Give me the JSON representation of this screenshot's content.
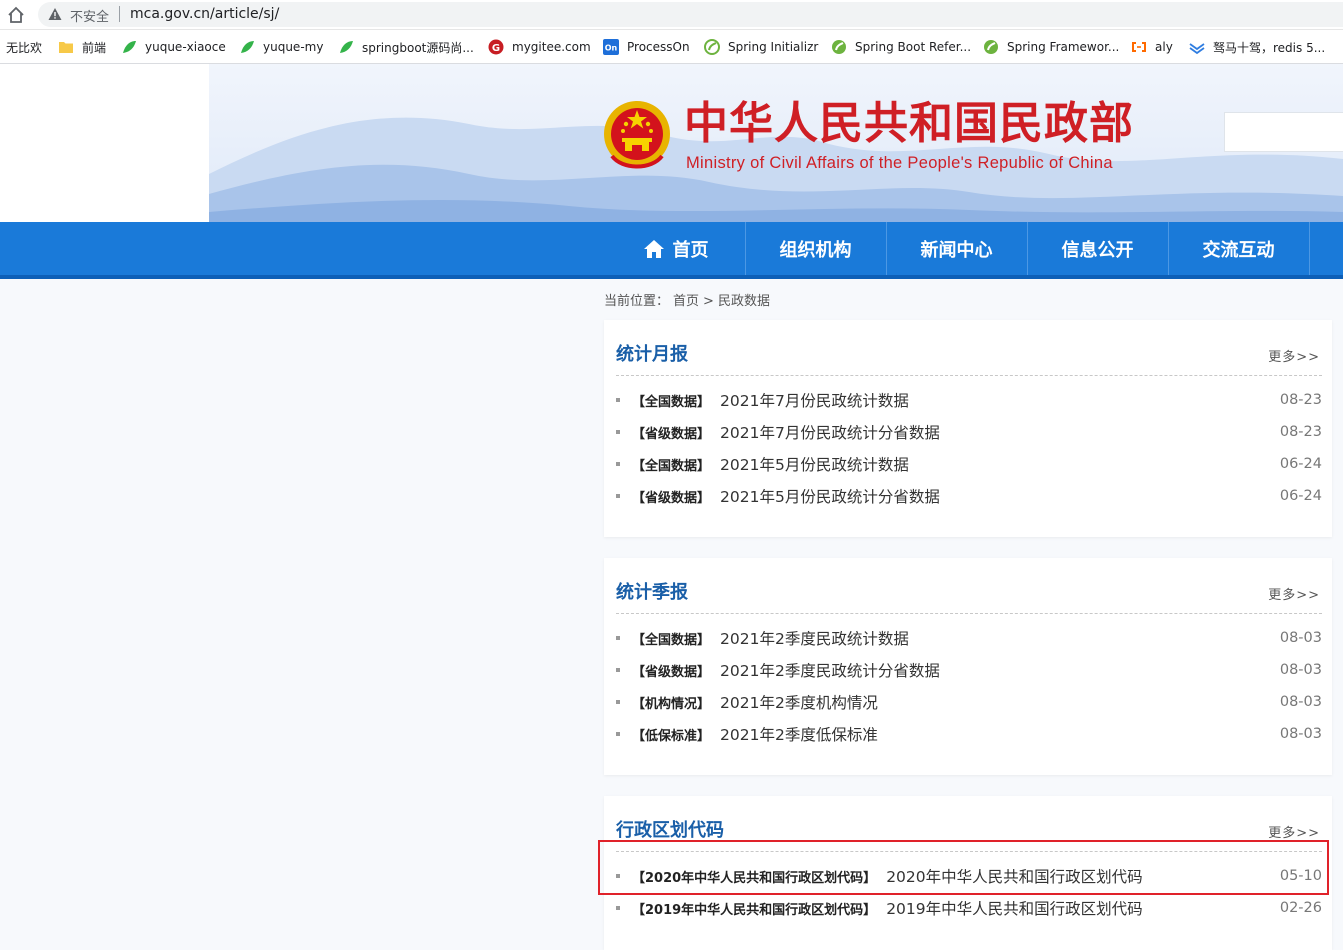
{
  "browser": {
    "insecure_label": "不安全",
    "url": "mca.gov.cn/article/sj/",
    "bookmarks": [
      {
        "label": "无比欢",
        "icon": "none"
      },
      {
        "label": "前端",
        "icon": "folder-icon"
      },
      {
        "label": "yuque-xiaoce",
        "icon": "yuque-icon"
      },
      {
        "label": "yuque-my",
        "icon": "yuque-icon"
      },
      {
        "label": "springboot源码尚...",
        "icon": "yuque-icon"
      },
      {
        "label": "mygitee.com",
        "icon": "gitee-icon"
      },
      {
        "label": "ProcessOn",
        "icon": "processon-icon"
      },
      {
        "label": "Spring Initializr",
        "icon": "spring-icon"
      },
      {
        "label": "Spring Boot Refer...",
        "icon": "spring-icon"
      },
      {
        "label": "Spring Framewor...",
        "icon": "spring-icon"
      },
      {
        "label": "aly",
        "icon": "aliyun-icon"
      },
      {
        "label": "驽马十驾，redis 5...",
        "icon": "bird-icon"
      }
    ]
  },
  "header": {
    "title_cn": "中华人民共和国民政部",
    "title_en": "Ministry of Civil Affairs of the People's Republic of China"
  },
  "nav": {
    "items": [
      "首页",
      "组织机构",
      "新闻中心",
      "信息公开",
      "交流互动"
    ]
  },
  "breadcrumb": {
    "prefix": "当前位置：",
    "home": "首页",
    "sep": ">",
    "current": "民政数据"
  },
  "panels": [
    {
      "title": "统计月报",
      "more": "更多>>",
      "rows": [
        {
          "tag": "【全国数据】",
          "title": "2021年7月份民政统计数据",
          "date": "08-23"
        },
        {
          "tag": "【省级数据】",
          "title": "2021年7月份民政统计分省数据",
          "date": "08-23"
        },
        {
          "tag": "【全国数据】",
          "title": "2021年5月份民政统计数据",
          "date": "06-24"
        },
        {
          "tag": "【省级数据】",
          "title": "2021年5月份民政统计分省数据",
          "date": "06-24"
        }
      ]
    },
    {
      "title": "统计季报",
      "more": "更多>>",
      "rows": [
        {
          "tag": "【全国数据】",
          "title": "2021年2季度民政统计数据",
          "date": "08-03"
        },
        {
          "tag": "【省级数据】",
          "title": "2021年2季度民政统计分省数据",
          "date": "08-03"
        },
        {
          "tag": "【机构情况】",
          "title": "2021年2季度机构情况",
          "date": "08-03"
        },
        {
          "tag": "【低保标准】",
          "title": "2021年2季度低保标准",
          "date": "08-03"
        }
      ]
    },
    {
      "title": "行政区划代码",
      "more": "更多>>",
      "rows": [
        {
          "tag": "【2020年中华人民共和国行政区划代码】",
          "title": "2020年中华人民共和国行政区划代码",
          "date": "05-10"
        },
        {
          "tag": "【2019年中华人民共和国行政区划代码】",
          "title": "2019年中华人民共和国行政区划代码",
          "date": "02-26"
        }
      ]
    }
  ],
  "colors": {
    "nav_blue": "#1a7ad9",
    "title_red": "#cf1f25",
    "panel_title_blue": "#1a5fa8",
    "highlight_red": "#e0222a"
  }
}
